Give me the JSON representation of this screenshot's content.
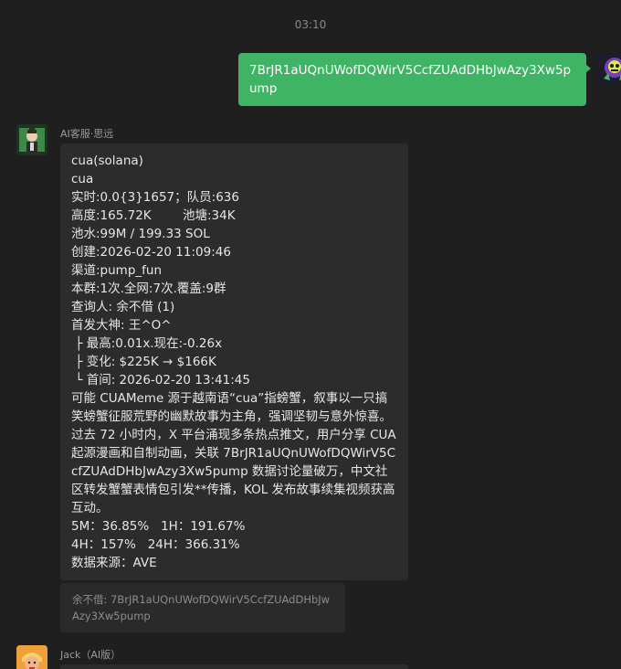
{
  "timestamp": "03:10",
  "outgoing_message": {
    "text": "7BrJR1aUQnUWofDQWirV5CcfZUAdDHbJwAzy3Xw5pump"
  },
  "ai_message": {
    "sender": "AI客服·思远",
    "lines": [
      "cua(solana)",
      "cua",
      "实时:0.0{3}1657；队员:636",
      "高度:165.72K        池塘:34K",
      "池水:99M / 199.33 SOL",
      "创建:2026-02-20 11:09:46",
      "渠道:pump_fun",
      "本群:1次.全网:7次.覆盖:9群",
      "查询人: 余不借 (1)",
      "首发大神: 王^O^",
      " ├ 最高:0.01x.现在:-0.26x",
      " ├ 变化: $225K → $166K",
      " └ 首间: 2026-02-20 13:41:45"
    ],
    "description": "可能 CUAMeme 源于越南语“cua”指螃蟹，叙事以一只搞笑螃蟹征服荒野的幽默故事为主角，强调坚韧与意外惊喜。过去 72 小时内，X 平台涌现多条热点推文，用户分享 CUA 起源漫画和自制动画，关联 7BrJR1aUQnUWofDQWirV5CcfZUAdDHbJwAzy3Xw5pump 数据讨论量破万，中文社区转发蟹蟹表情包引发**传播，KOL 发布故事续集视频获高互动。",
    "stats_line1": "5M：36.85%   1H：191.67%",
    "stats_line2": "4H：157%   24H：366.31%",
    "source": "数据来源：AVE"
  },
  "quote": {
    "text": "余不借: 7BrJR1aUQnUWofDQWirV5CcfZUAdDHbJwAzy3Xw5pump"
  },
  "jack_message": {
    "sender": "Jack（AI版）"
  },
  "colors": {
    "background": "#1f1f1f",
    "outgoing_bubble": "#3fb464",
    "incoming_bubble": "#2c2c2c"
  }
}
